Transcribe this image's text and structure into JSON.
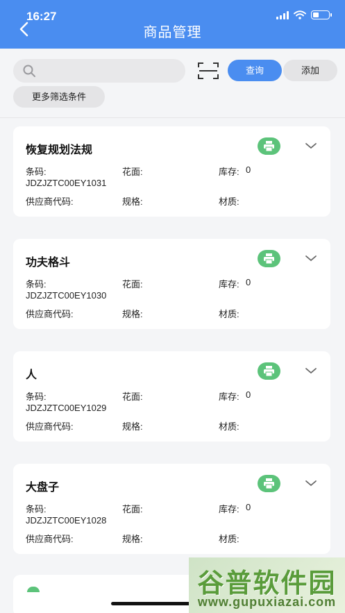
{
  "status_bar": {
    "time": "16:27"
  },
  "header": {
    "title": "商品管理"
  },
  "search": {
    "placeholder": "",
    "value": ""
  },
  "toolbar": {
    "query_label": "查询",
    "add_label": "添加",
    "more_filters_label": "更多筛选条件"
  },
  "field_labels": {
    "barcode": "条码:",
    "pattern": "花面:",
    "stock": "库存:",
    "supplier_code": "供应商代码:",
    "spec": "规格:",
    "material": "材质:"
  },
  "products": [
    {
      "name": "恢复规划法规",
      "code": "JDZJZTC00EY1031",
      "stock": "0"
    },
    {
      "name": "功夫格斗",
      "code": "JDZJZTC00EY1030",
      "stock": "0"
    },
    {
      "name": "人",
      "code": "JDZJZTC00EY1029",
      "stock": "0"
    },
    {
      "name": "大盘子",
      "code": "JDZJZTC00EY1028",
      "stock": "0"
    }
  ],
  "watermark": {
    "title": "谷普软件园",
    "url": "www.gupuxiazai.com"
  },
  "colors": {
    "accent": "#4a8df0",
    "print_green": "#5cc37a",
    "background": "#f4f5f7"
  },
  "icons": [
    "back-arrow-icon",
    "search-icon",
    "scan-icon",
    "printer-icon",
    "chevron-down-icon"
  ]
}
